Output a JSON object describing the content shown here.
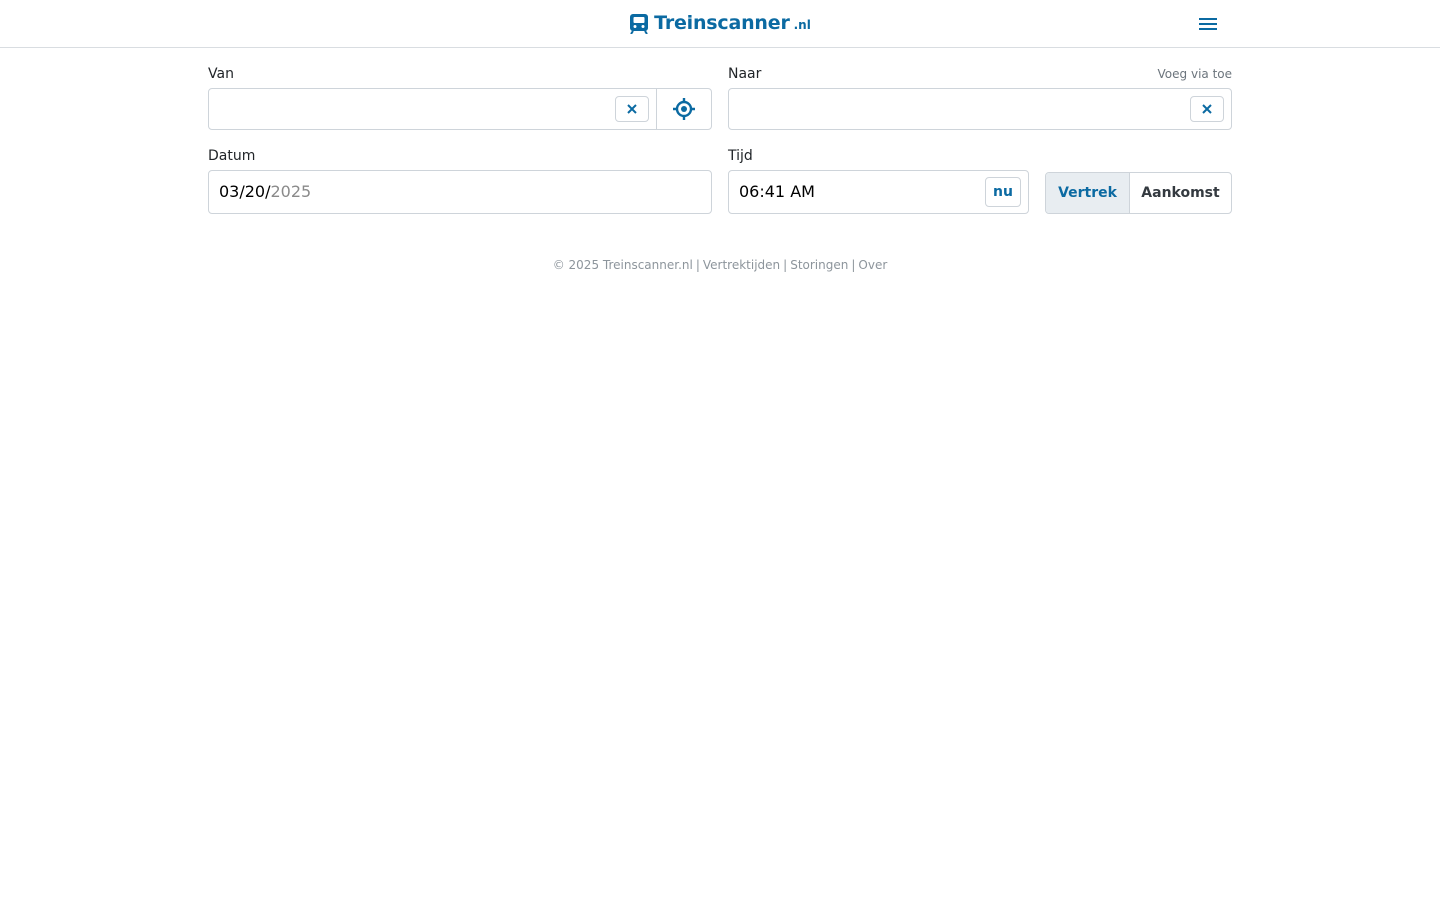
{
  "header": {
    "logo_name": "Treinscanner",
    "logo_tld": ".nl",
    "menu_icon": "hamburger-menu-icon"
  },
  "form": {
    "from_label": "Van",
    "from_value": "",
    "to_label": "Naar",
    "add_via_label": "Voeg via toe",
    "to_value": "",
    "date_label": "Datum",
    "date_value_main": "03/20/",
    "date_value_year": "2025",
    "time_label": "Tijd",
    "time_value": "06:41 AM",
    "now_button": "nu",
    "mode_departure": "Vertrek",
    "mode_arrival": "Aankomst",
    "selected_mode": "Vertrek"
  },
  "footer": {
    "copyright": "© 2025 Treinscanner.nl",
    "links": [
      "Vertrektijden",
      "Storingen",
      "Over"
    ]
  },
  "colors": {
    "brand": "#0b6aa2",
    "border": "#ced4da",
    "selected_bg": "#e8edf1",
    "footer_text": "#8d959c"
  }
}
